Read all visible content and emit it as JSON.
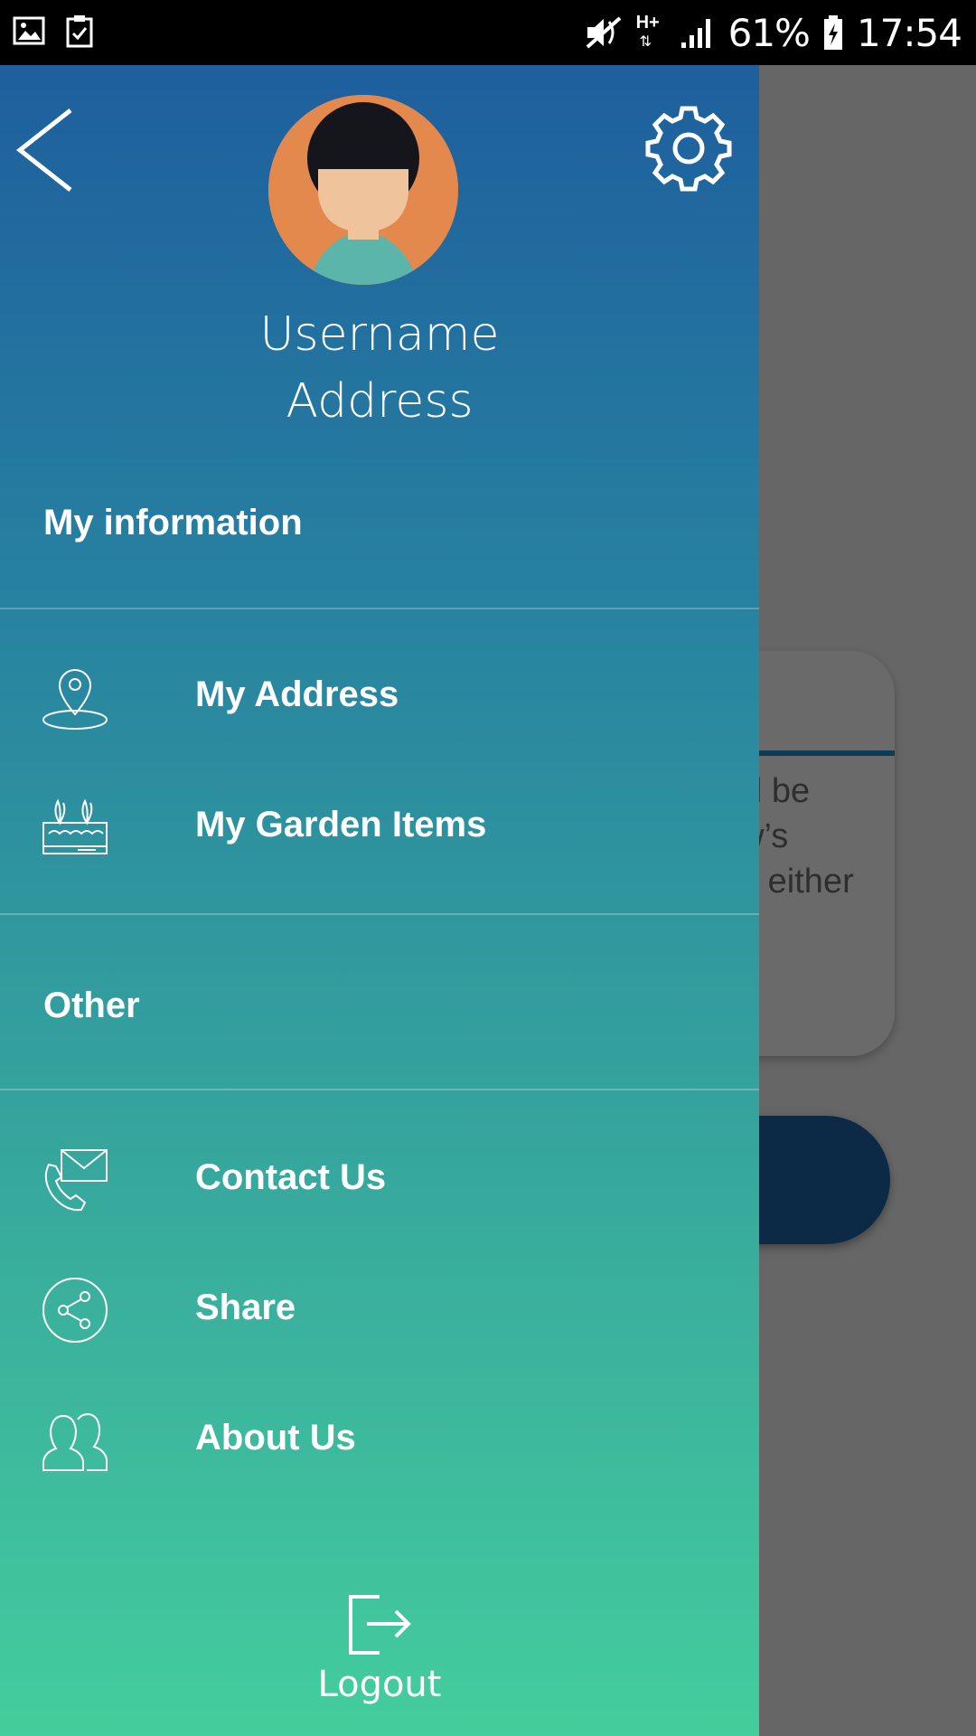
{
  "status_bar": {
    "battery": "61%",
    "time": "17:54",
    "network": "H+",
    "icons": [
      "gallery-icon",
      "task-check-icon",
      "mute-icon",
      "network-hplus-icon",
      "signal-icon",
      "battery-charging-icon"
    ]
  },
  "drawer": {
    "back_icon": "chevron-left-icon",
    "settings_icon": "gear-icon",
    "profile": {
      "username": "Username",
      "address": "Address"
    },
    "sections": [
      {
        "title": "My information",
        "items": [
          {
            "label": "My Address",
            "icon": "location-pin-icon"
          },
          {
            "label": "My Garden Items",
            "icon": "garden-planter-icon"
          }
        ]
      },
      {
        "title": "Other",
        "items": [
          {
            "label": "Contact Us",
            "icon": "phone-mail-icon"
          },
          {
            "label": "Share",
            "icon": "share-icon"
          },
          {
            "label": "About Us",
            "icon": "people-icon"
          }
        ]
      }
    ],
    "logout_label": "Logout"
  },
  "background": {
    "card_text_lines": [
      "ill be",
      "w’s",
      "t, either"
    ]
  },
  "colors": {
    "drawer_top": "#1e5f9e",
    "drawer_bottom": "#44cd9d",
    "scrim": "#666666"
  }
}
